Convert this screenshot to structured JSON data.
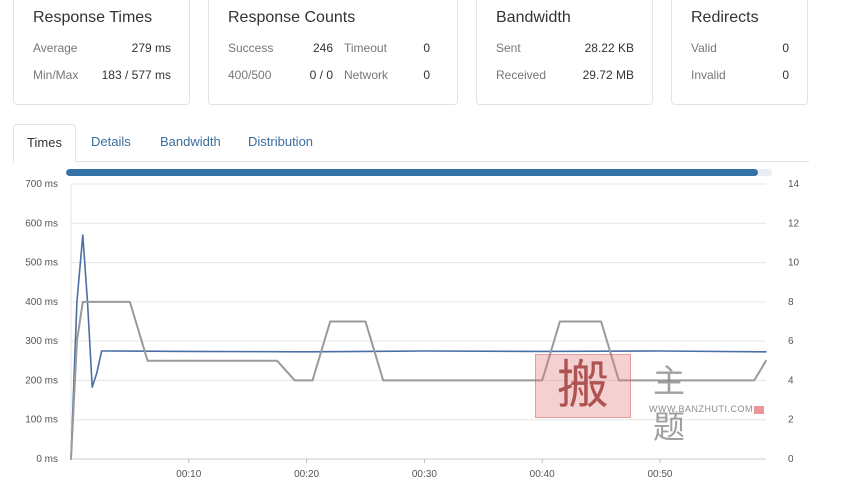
{
  "cards": {
    "response_times": {
      "title": "Response Times",
      "average_label": "Average",
      "average_value": "279 ms",
      "minmax_label": "Min/Max",
      "minmax_value": "183 / 577 ms"
    },
    "response_counts": {
      "title": "Response Counts",
      "success_label": "Success",
      "success_value": "246",
      "timeout_label": "Timeout",
      "timeout_value": "0",
      "status_label": "400/500",
      "status_value": "0 / 0",
      "network_label": "Network",
      "network_value": "0"
    },
    "bandwidth": {
      "title": "Bandwidth",
      "sent_label": "Sent",
      "sent_value": "28.22 KB",
      "received_label": "Received",
      "received_value": "29.72 MB"
    },
    "redirects": {
      "title": "Redirects",
      "valid_label": "Valid",
      "valid_value": "0",
      "invalid_label": "Invalid",
      "invalid_value": "0"
    }
  },
  "tabs": [
    {
      "label": "Times",
      "active": true
    },
    {
      "label": "Details",
      "active": false
    },
    {
      "label": "Bandwidth",
      "active": false
    },
    {
      "label": "Distribution",
      "active": false
    }
  ],
  "progress": {
    "value": 0.98
  },
  "watermark": {
    "glyph": "搬",
    "text": "主 题",
    "url": "WWW.BANZHUTI.COM"
  },
  "chart_data": {
    "type": "line",
    "x_ticks": [
      "00:10",
      "00:20",
      "00:30",
      "00:40",
      "00:50"
    ],
    "x_tick_seconds": [
      10,
      20,
      30,
      40,
      50
    ],
    "xlim": [
      0,
      59
    ],
    "y_left_ticks": [
      "0 ms",
      "100 ms",
      "200 ms",
      "300 ms",
      "400 ms",
      "500 ms",
      "600 ms",
      "700 ms"
    ],
    "ylim_left": [
      0,
      700
    ],
    "y_right_ticks": [
      "0",
      "2",
      "4",
      "6",
      "8",
      "10",
      "12",
      "14"
    ],
    "ylim_right": [
      0,
      14
    ],
    "grid": true,
    "series": [
      {
        "axis": "left",
        "color": "#4a6fa5",
        "x": [
          0,
          0.5,
          1,
          1.4,
          1.8,
          2.2,
          2.6,
          3,
          10,
          20,
          30,
          40,
          50,
          59
        ],
        "y": [
          0,
          400,
          570,
          400,
          183,
          220,
          275,
          275,
          274,
          273,
          275,
          274,
          275,
          273
        ]
      },
      {
        "axis": "right",
        "color": "#9a9a9a",
        "x": [
          0,
          0.5,
          1,
          5,
          6.5,
          17.5,
          19,
          20.5,
          22,
          25,
          26.5,
          40,
          41.5,
          45,
          46.5,
          58,
          59
        ],
        "y": [
          0,
          6,
          8,
          8,
          5,
          5,
          4,
          4,
          7,
          7,
          4,
          4,
          7,
          7,
          4,
          4,
          5
        ]
      }
    ]
  }
}
